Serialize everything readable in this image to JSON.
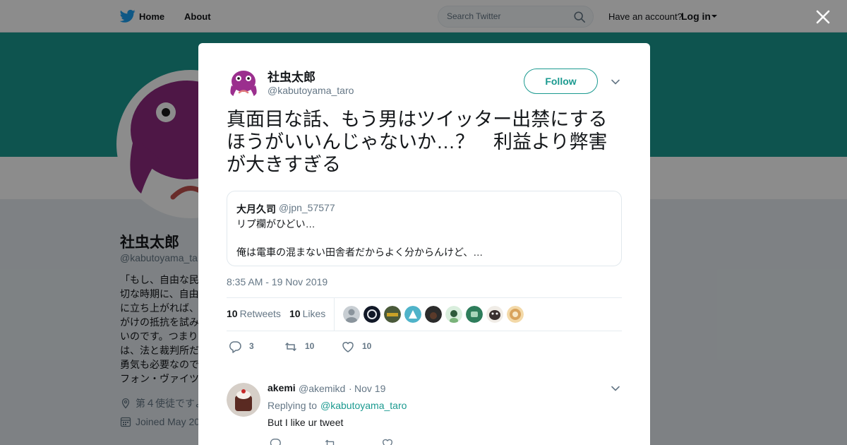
{
  "nav": {
    "home_label": "Home",
    "about_label": "About",
    "search_placeholder": "Search Twitter",
    "have_account": "Have an account?",
    "login_label": "Log in"
  },
  "colors": {
    "brand": "#1DA1F2",
    "profile_accent": "#1B9A90",
    "banner": "#1B9A90"
  },
  "profile": {
    "name": "社虫太郎",
    "handle": "@kabutoyama_ta",
    "bio_lines": [
      "「もし、自由な民",
      "切な時期に、自由",
      "に立ち上がれば、",
      "がけの抵抗を試み",
      "いのです。つまり",
      "は、法と裁判所だ",
      "勇気も必要なので",
      "フォン・ヴァイツ"
    ],
    "location": "第４使徒ですよ",
    "joined": "Joined May 20"
  },
  "tweet": {
    "author_name": "社虫太郎",
    "author_handle": "@kabutoyama_taro",
    "follow_label": "Follow",
    "text_lines": [
      "真面目な話、もう男はツイッター出禁にする",
      "ほうがいいんじゃないか…？　利益より弊害",
      "が大きすぎる"
    ],
    "quote": {
      "name": "大月久司",
      "handle": "@jpn_57577",
      "line1": "リプ欄がひどい…",
      "line2": "俺は電車の混まない田舎者だからよく分からんけど、…"
    },
    "timestamp": "8:35 AM - 19 Nov 2019",
    "retweets_count": "10",
    "retweets_label": "Retweets",
    "likes_count": "10",
    "likes_label": "Likes",
    "liker_colors": [
      "#9aa3ab",
      "#1a1a2e",
      "#4a5a3a",
      "#4fb3c9",
      "#2b2b2b",
      "#7ab37a",
      "#2e7d5b",
      "#3a3030",
      "#d9a35c"
    ],
    "actions": {
      "reply_count": "3",
      "retweet_count": "10",
      "like_count": "10"
    }
  },
  "reply": {
    "name": "akemi",
    "handle": "@akemikd",
    "separator": "·",
    "date": "Nov 19",
    "replying_to_label": "Replying to",
    "replying_to_handle": "@kabutoyama_taro",
    "text": "But I like ur tweet"
  }
}
